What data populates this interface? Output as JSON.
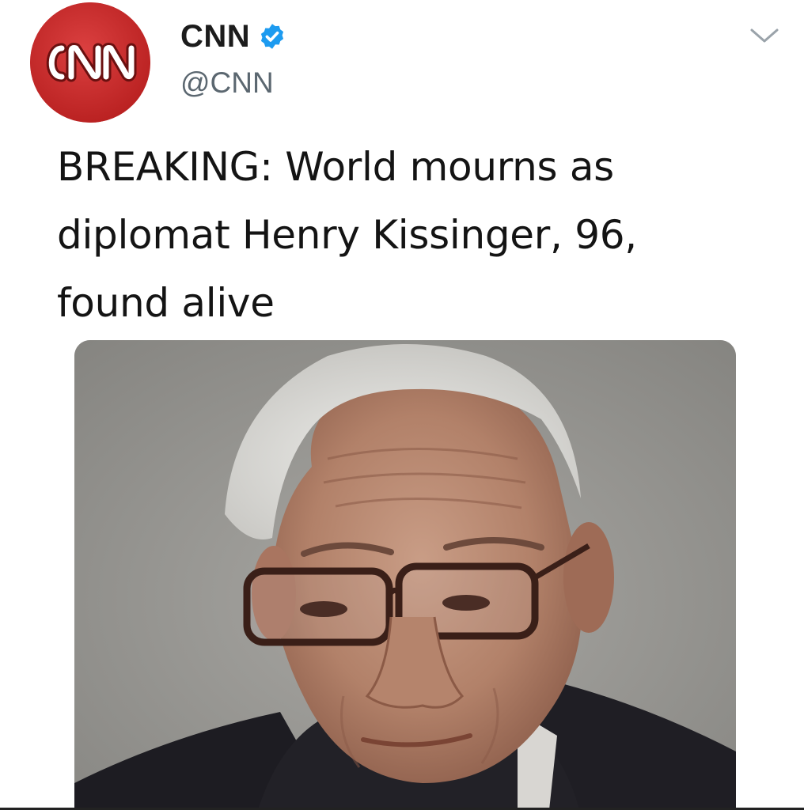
{
  "tweet": {
    "author": {
      "avatar_logo": "CNN",
      "display_name": "CNN",
      "handle": "@CNN",
      "verified": true
    },
    "text": "BREAKING: World mourns as\ndiplomat Henry Kissinger, 96,\nfound alive",
    "media": {
      "type": "photo"
    }
  },
  "icons": {
    "verified": "verified-badge-icon",
    "menu": "chevron-down-icon"
  },
  "colors": {
    "brand_red": "#c42727",
    "verified_blue": "#1d9bf0",
    "text": "#141414",
    "handle_gray": "#5b6770"
  }
}
